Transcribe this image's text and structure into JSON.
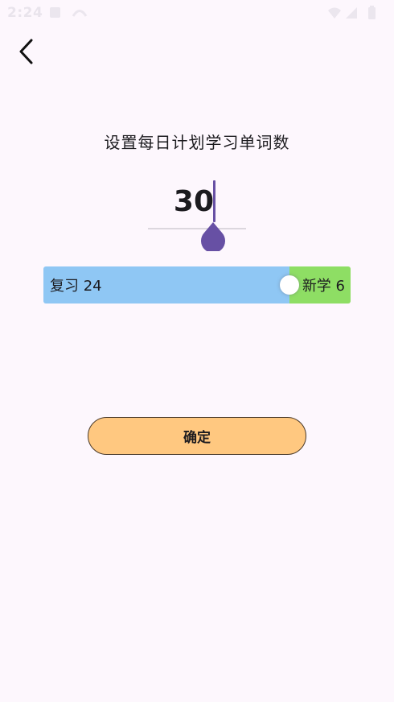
{
  "status_bar": {
    "time": "2:24",
    "icons": [
      "notification-icon",
      "cast-icon",
      "wifi-icon",
      "signal-icon",
      "battery-icon"
    ]
  },
  "header": {
    "back_icon": "chevron-left-icon"
  },
  "plan": {
    "title": "设置每日计划学习单词数",
    "count": "30"
  },
  "ratio": {
    "review_label": "复习 24",
    "new_label": "新学 6",
    "review_count": 24,
    "new_count": 6,
    "review_color": "#8fc7f4",
    "new_color": "#8ede64"
  },
  "confirm": {
    "label": "确定",
    "color": "#ffc880"
  },
  "theme": {
    "background": "#fdf7fd",
    "accent": "#6750a4"
  }
}
